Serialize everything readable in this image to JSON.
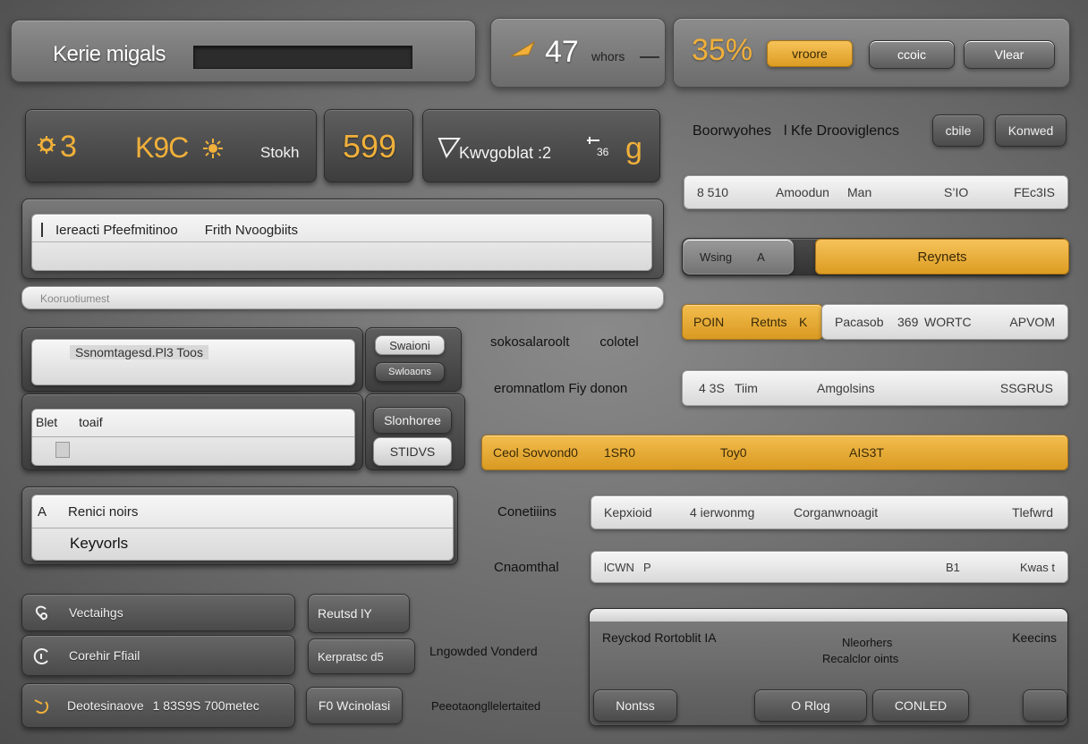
{
  "header": {
    "app_title": "Kerie migals",
    "stat_number": "47",
    "stat_unit": "whors",
    "percent": "35%",
    "btn_primary": "vroore",
    "btn_second": "ccoic",
    "btn_view": "Vlear"
  },
  "stats": {
    "card1_value": "3",
    "card1_code": "K9C",
    "card1_label": "Stokh",
    "card2_value": "599",
    "card3_label": "Kwvgoblat :2",
    "card3_small": "36",
    "card3_value": "g"
  },
  "right_header": {
    "title_a": "Boorwyohes",
    "title_b": "l Kfe Drooviglencs",
    "btn_a": "cbile",
    "btn_b": "Konwed"
  },
  "table": {
    "row1": [
      "8 510",
      "Amoodun",
      "Man",
      "S’IO",
      "FEc3IS"
    ],
    "toggle_left": "Wsing",
    "toggle_left_b": "A",
    "toggle_right": "Reynets",
    "row3_gold_a": "POIN",
    "row3_gold_b": "Retnts",
    "row3_gold_c": "K",
    "row3_a": "Pacasob",
    "row3_b": "369",
    "row3_c": "WORTC",
    "row3_d": "APVOM",
    "row4": [
      "4 3S",
      "Tiim",
      "Amgolsins",
      "SSGRUS"
    ],
    "gold_row": [
      "Ceol Sovvond0",
      "1SR0",
      "Toy0",
      "AIS3T"
    ]
  },
  "left_form": {
    "field_title_a": "Iereacti Pfeefmitinoo",
    "field_title_b": "Frith Nvoogbiits",
    "strip_label": "Kooruotiumest",
    "input1": "Ssnomtagesd.Pl3 Toos",
    "side_btn1": "Swaioni",
    "side_btn2": "Swloaons",
    "center_label1": "sokosalaroolt",
    "center_label1b": "colotel",
    "input2_label": "Blet",
    "input2_value": "toaif",
    "side_btn3": "Slonhoree",
    "side_btn4": "STIDVS",
    "center_label2": "eromnatlom Fiy donon",
    "list_letter": "A",
    "list_item1": "Renici noirs",
    "list_item2": "Keyvorls"
  },
  "right_rows": {
    "label1": "Conetiiins",
    "row1": [
      "Kepxioid",
      "4 ierwonmg",
      "Corganwnoagit",
      "Tlefwrd"
    ],
    "label2": "Cnaomthal",
    "row2": [
      "lCWN",
      "P",
      "B1",
      "Kwas t"
    ]
  },
  "bottom_left": {
    "item1": "Vectaihgs",
    "item2": "Corehir Ffiail",
    "item3": "Deotesinaove",
    "item3_value": "1 83S9S 700metec",
    "btn1": "Reutsd lY",
    "btn2": "Kerpratsc d5",
    "btn3": "F0 Wcinolasi",
    "label1": "Lngowded Vonderd",
    "label2": "Peeotaongllelertaited"
  },
  "bottom_right": {
    "title": "Reyckod Rortoblit IA",
    "center_a": "Nleorhers",
    "center_b": "Recalclor oints",
    "right": "Keecins",
    "btn1": "Nontss",
    "btn2": "O Rlog",
    "btn3": "CONLED"
  },
  "colors": {
    "accent_gold": "#f0b03a",
    "panel_dark": "#4a4a4a",
    "panel_light": "#e6e6e6"
  }
}
